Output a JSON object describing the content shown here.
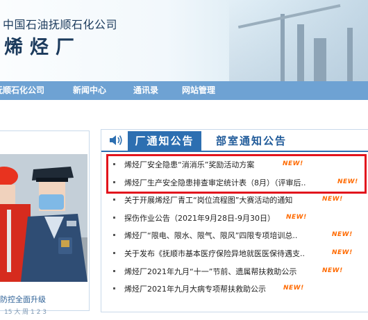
{
  "header": {
    "company": "中国石油抚顺石化公司",
    "department": "烯烃厂"
  },
  "nav": {
    "items": [
      {
        "label": "抚顺石化公司"
      },
      {
        "label": "新闻中心"
      },
      {
        "label": "通讯录"
      },
      {
        "label": "网站管理"
      }
    ]
  },
  "feature": {
    "caption": "防控全面升级",
    "dots": "15 大 周 1 2 3"
  },
  "notices": {
    "tabs": [
      {
        "label": "厂通知公告",
        "active": true
      },
      {
        "label": "部室通知公告",
        "active": false
      }
    ],
    "new_badge": "NEW!",
    "items": [
      {
        "title": "烯烃厂安全隐患“消消乐”奖励活动方案"
      },
      {
        "title": "烯烃厂生产安全隐患排查审定统计表（8月）（评审后.."
      },
      {
        "title": "关于开展烯烃厂青工“岗位流程图”大赛活动的通知"
      },
      {
        "title": "探伤作业公告（2021年9月28日-9月30日）"
      },
      {
        "title": "烯烃厂“限电、限水、限气、限风”四限专项培训总.."
      },
      {
        "title": "关于发布《抚顺市基本医疗保险异地就医医保待遇支.."
      },
      {
        "title": "烯烃厂2021年九月“十一”节前、遗属帮扶救助公示"
      },
      {
        "title": "烯烃厂2021年九月大病专项帮扶救助公示"
      }
    ]
  },
  "colors": {
    "nav_bg": "#6ea2d3",
    "tab_active_bg": "#2d6fb1",
    "highlight_border": "#e2141d",
    "badge": "#ff6a00"
  }
}
